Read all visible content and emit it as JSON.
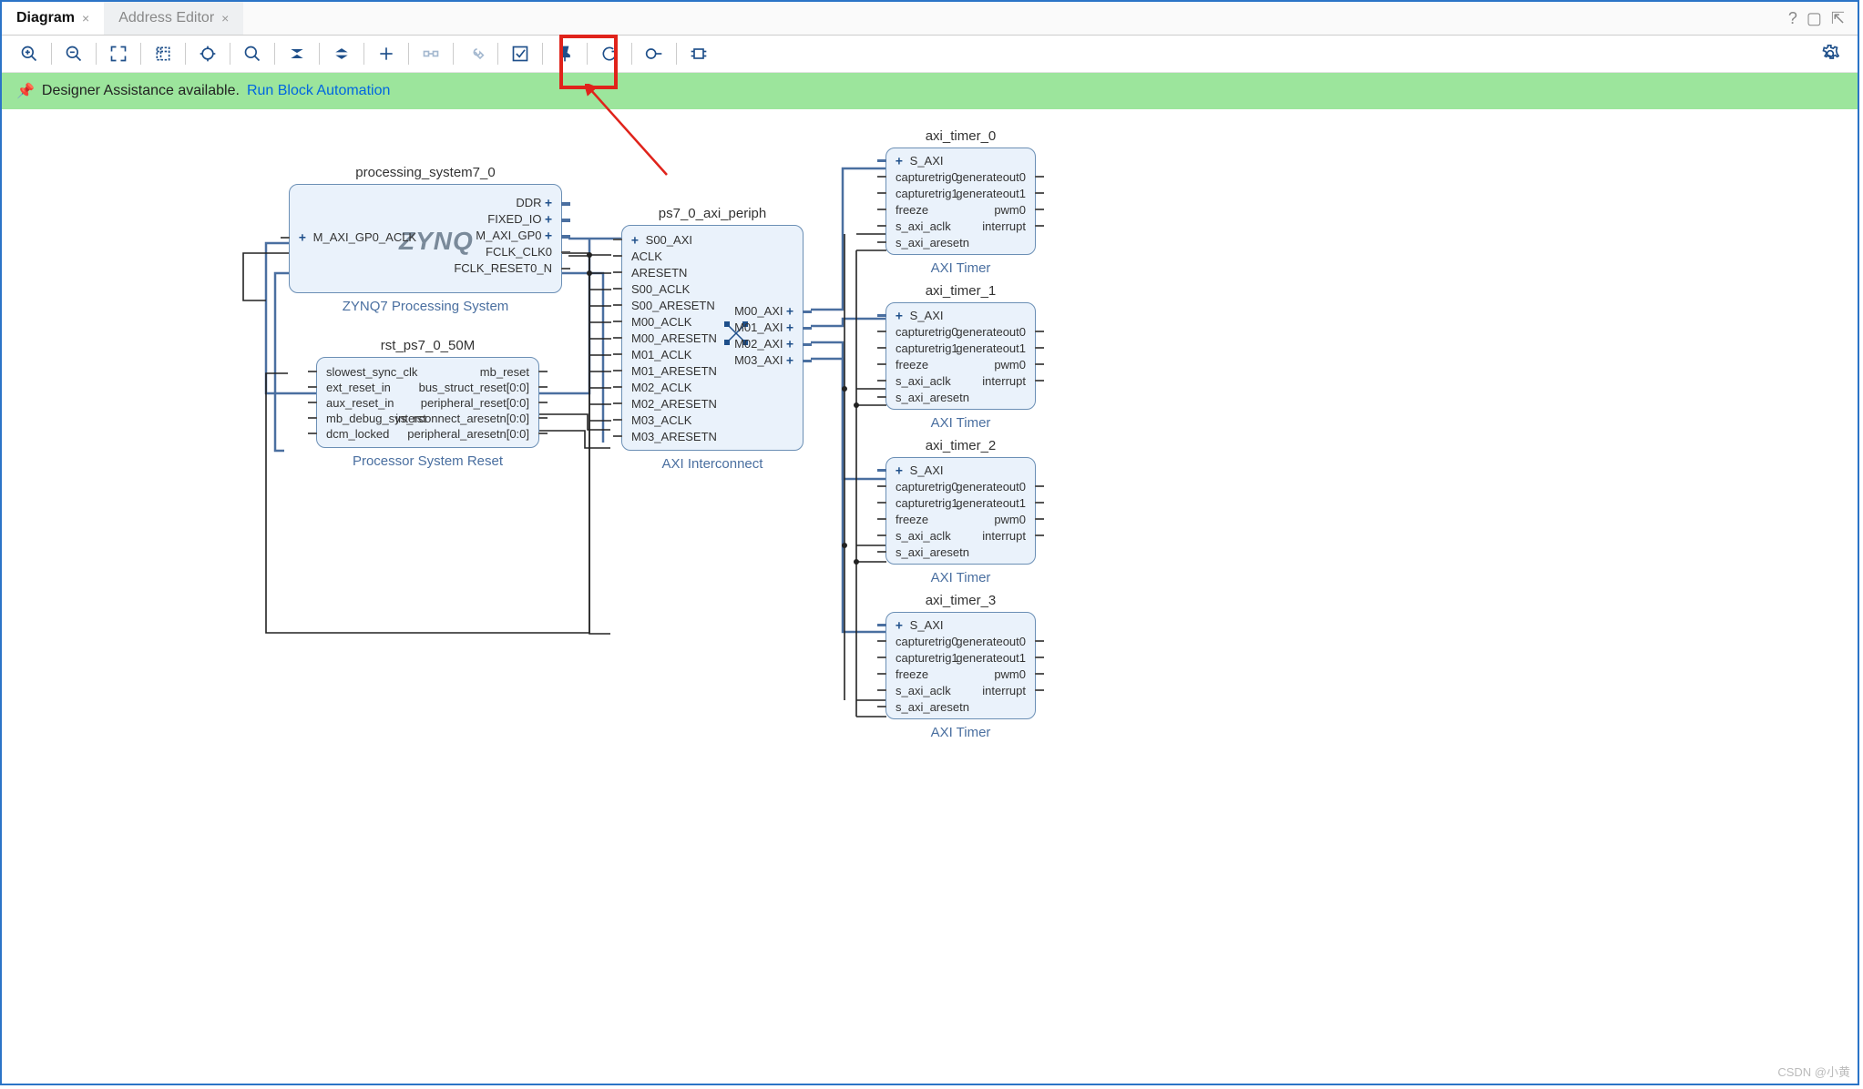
{
  "tabs": {
    "diagram": "Diagram",
    "address": "Address Editor"
  },
  "banner": {
    "msg": "Designer Assistance available.",
    "link": "Run Block Automation"
  },
  "ps7": {
    "name": "processing_system7_0",
    "type": "ZYNQ7 Processing System",
    "logo": "ZYNQ",
    "pl": [
      "M_AXI_GP0_ACLK"
    ],
    "pr": [
      "DDR",
      "FIXED_IO",
      "M_AXI_GP0",
      "FCLK_CLK0",
      "FCLK_RESET0_N"
    ]
  },
  "rst": {
    "name": "rst_ps7_0_50M",
    "type": "Processor System Reset",
    "pl": [
      "slowest_sync_clk",
      "ext_reset_in",
      "aux_reset_in",
      "mb_debug_sys_rst",
      "dcm_locked"
    ],
    "pr": [
      "mb_reset",
      "bus_struct_reset[0:0]",
      "peripheral_reset[0:0]",
      "interconnect_aresetn[0:0]",
      "peripheral_aresetn[0:0]"
    ]
  },
  "ic": {
    "name": "ps7_0_axi_periph",
    "type": "AXI Interconnect",
    "pl": [
      "S00_AXI",
      "ACLK",
      "ARESETN",
      "S00_ACLK",
      "S00_ARESETN",
      "M00_ACLK",
      "M00_ARESETN",
      "M01_ACLK",
      "M01_ARESETN",
      "M02_ACLK",
      "M02_ARESETN",
      "M03_ACLK",
      "M03_ARESETN"
    ],
    "pr": [
      "M00_AXI",
      "M01_AXI",
      "M02_AXI",
      "M03_AXI"
    ]
  },
  "timer": {
    "names": [
      "axi_timer_0",
      "axi_timer_1",
      "axi_timer_2",
      "axi_timer_3"
    ],
    "type": "AXI Timer",
    "pl": [
      "S_AXI",
      "capturetrig0",
      "capturetrig1",
      "freeze",
      "s_axi_aclk",
      "s_axi_aresetn"
    ],
    "pr": [
      "",
      "generateout0",
      "generateout1",
      "pwm0",
      "interrupt",
      ""
    ]
  },
  "watermark": "CSDN @小黄"
}
